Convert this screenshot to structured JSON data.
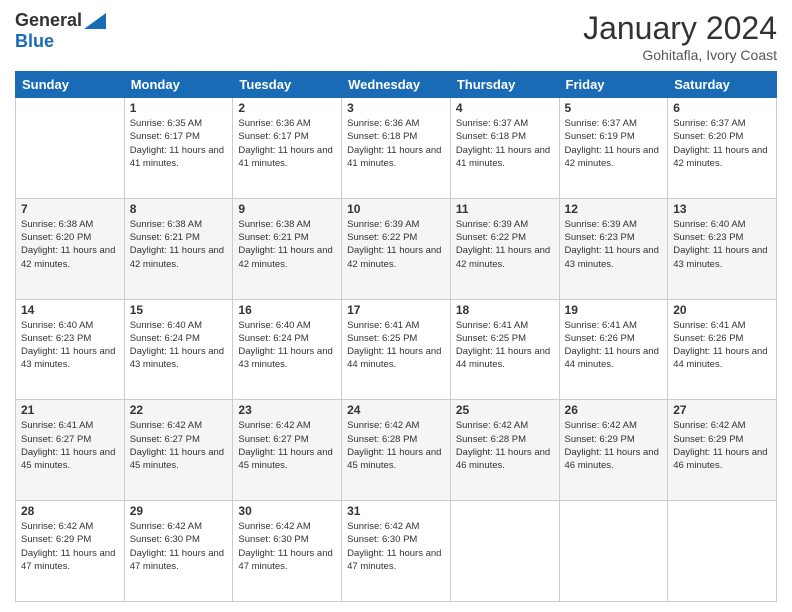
{
  "logo": {
    "general": "General",
    "blue": "Blue"
  },
  "title": "January 2024",
  "location": "Gohitafla, Ivory Coast",
  "days_of_week": [
    "Sunday",
    "Monday",
    "Tuesday",
    "Wednesday",
    "Thursday",
    "Friday",
    "Saturday"
  ],
  "weeks": [
    [
      {
        "day": null,
        "sunrise": null,
        "sunset": null,
        "daylight": null
      },
      {
        "day": "1",
        "sunrise": "Sunrise: 6:35 AM",
        "sunset": "Sunset: 6:17 PM",
        "daylight": "Daylight: 11 hours and 41 minutes."
      },
      {
        "day": "2",
        "sunrise": "Sunrise: 6:36 AM",
        "sunset": "Sunset: 6:17 PM",
        "daylight": "Daylight: 11 hours and 41 minutes."
      },
      {
        "day": "3",
        "sunrise": "Sunrise: 6:36 AM",
        "sunset": "Sunset: 6:18 PM",
        "daylight": "Daylight: 11 hours and 41 minutes."
      },
      {
        "day": "4",
        "sunrise": "Sunrise: 6:37 AM",
        "sunset": "Sunset: 6:18 PM",
        "daylight": "Daylight: 11 hours and 41 minutes."
      },
      {
        "day": "5",
        "sunrise": "Sunrise: 6:37 AM",
        "sunset": "Sunset: 6:19 PM",
        "daylight": "Daylight: 11 hours and 42 minutes."
      },
      {
        "day": "6",
        "sunrise": "Sunrise: 6:37 AM",
        "sunset": "Sunset: 6:20 PM",
        "daylight": "Daylight: 11 hours and 42 minutes."
      }
    ],
    [
      {
        "day": "7",
        "sunrise": "Sunrise: 6:38 AM",
        "sunset": "Sunset: 6:20 PM",
        "daylight": "Daylight: 11 hours and 42 minutes."
      },
      {
        "day": "8",
        "sunrise": "Sunrise: 6:38 AM",
        "sunset": "Sunset: 6:21 PM",
        "daylight": "Daylight: 11 hours and 42 minutes."
      },
      {
        "day": "9",
        "sunrise": "Sunrise: 6:38 AM",
        "sunset": "Sunset: 6:21 PM",
        "daylight": "Daylight: 11 hours and 42 minutes."
      },
      {
        "day": "10",
        "sunrise": "Sunrise: 6:39 AM",
        "sunset": "Sunset: 6:22 PM",
        "daylight": "Daylight: 11 hours and 42 minutes."
      },
      {
        "day": "11",
        "sunrise": "Sunrise: 6:39 AM",
        "sunset": "Sunset: 6:22 PM",
        "daylight": "Daylight: 11 hours and 42 minutes."
      },
      {
        "day": "12",
        "sunrise": "Sunrise: 6:39 AM",
        "sunset": "Sunset: 6:23 PM",
        "daylight": "Daylight: 11 hours and 43 minutes."
      },
      {
        "day": "13",
        "sunrise": "Sunrise: 6:40 AM",
        "sunset": "Sunset: 6:23 PM",
        "daylight": "Daylight: 11 hours and 43 minutes."
      }
    ],
    [
      {
        "day": "14",
        "sunrise": "Sunrise: 6:40 AM",
        "sunset": "Sunset: 6:23 PM",
        "daylight": "Daylight: 11 hours and 43 minutes."
      },
      {
        "day": "15",
        "sunrise": "Sunrise: 6:40 AM",
        "sunset": "Sunset: 6:24 PM",
        "daylight": "Daylight: 11 hours and 43 minutes."
      },
      {
        "day": "16",
        "sunrise": "Sunrise: 6:40 AM",
        "sunset": "Sunset: 6:24 PM",
        "daylight": "Daylight: 11 hours and 43 minutes."
      },
      {
        "day": "17",
        "sunrise": "Sunrise: 6:41 AM",
        "sunset": "Sunset: 6:25 PM",
        "daylight": "Daylight: 11 hours and 44 minutes."
      },
      {
        "day": "18",
        "sunrise": "Sunrise: 6:41 AM",
        "sunset": "Sunset: 6:25 PM",
        "daylight": "Daylight: 11 hours and 44 minutes."
      },
      {
        "day": "19",
        "sunrise": "Sunrise: 6:41 AM",
        "sunset": "Sunset: 6:26 PM",
        "daylight": "Daylight: 11 hours and 44 minutes."
      },
      {
        "day": "20",
        "sunrise": "Sunrise: 6:41 AM",
        "sunset": "Sunset: 6:26 PM",
        "daylight": "Daylight: 11 hours and 44 minutes."
      }
    ],
    [
      {
        "day": "21",
        "sunrise": "Sunrise: 6:41 AM",
        "sunset": "Sunset: 6:27 PM",
        "daylight": "Daylight: 11 hours and 45 minutes."
      },
      {
        "day": "22",
        "sunrise": "Sunrise: 6:42 AM",
        "sunset": "Sunset: 6:27 PM",
        "daylight": "Daylight: 11 hours and 45 minutes."
      },
      {
        "day": "23",
        "sunrise": "Sunrise: 6:42 AM",
        "sunset": "Sunset: 6:27 PM",
        "daylight": "Daylight: 11 hours and 45 minutes."
      },
      {
        "day": "24",
        "sunrise": "Sunrise: 6:42 AM",
        "sunset": "Sunset: 6:28 PM",
        "daylight": "Daylight: 11 hours and 45 minutes."
      },
      {
        "day": "25",
        "sunrise": "Sunrise: 6:42 AM",
        "sunset": "Sunset: 6:28 PM",
        "daylight": "Daylight: 11 hours and 46 minutes."
      },
      {
        "day": "26",
        "sunrise": "Sunrise: 6:42 AM",
        "sunset": "Sunset: 6:29 PM",
        "daylight": "Daylight: 11 hours and 46 minutes."
      },
      {
        "day": "27",
        "sunrise": "Sunrise: 6:42 AM",
        "sunset": "Sunset: 6:29 PM",
        "daylight": "Daylight: 11 hours and 46 minutes."
      }
    ],
    [
      {
        "day": "28",
        "sunrise": "Sunrise: 6:42 AM",
        "sunset": "Sunset: 6:29 PM",
        "daylight": "Daylight: 11 hours and 47 minutes."
      },
      {
        "day": "29",
        "sunrise": "Sunrise: 6:42 AM",
        "sunset": "Sunset: 6:30 PM",
        "daylight": "Daylight: 11 hours and 47 minutes."
      },
      {
        "day": "30",
        "sunrise": "Sunrise: 6:42 AM",
        "sunset": "Sunset: 6:30 PM",
        "daylight": "Daylight: 11 hours and 47 minutes."
      },
      {
        "day": "31",
        "sunrise": "Sunrise: 6:42 AM",
        "sunset": "Sunset: 6:30 PM",
        "daylight": "Daylight: 11 hours and 47 minutes."
      },
      {
        "day": null,
        "sunrise": null,
        "sunset": null,
        "daylight": null
      },
      {
        "day": null,
        "sunrise": null,
        "sunset": null,
        "daylight": null
      },
      {
        "day": null,
        "sunrise": null,
        "sunset": null,
        "daylight": null
      }
    ]
  ]
}
